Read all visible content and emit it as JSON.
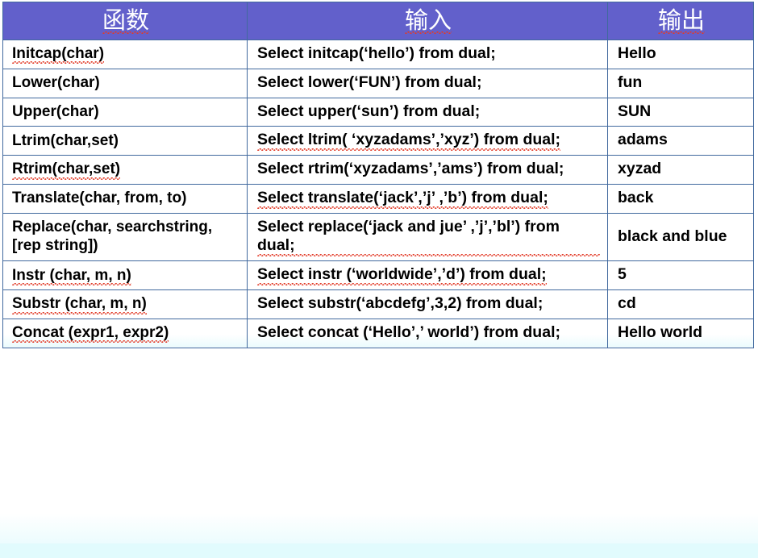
{
  "table": {
    "headers": [
      "函数",
      "输入",
      "输出"
    ],
    "rows": [
      {
        "function": "Initcap(char)",
        "input": "Select initcap(‘hello’) from dual;",
        "output": "Hello"
      },
      {
        "function": "Lower(char)",
        "input": "Select lower(‘FUN’) from dual;",
        "output": "fun"
      },
      {
        "function": "Upper(char)",
        "input": "Select upper(‘sun’) from dual;",
        "output": "SUN"
      },
      {
        "function": "Ltrim(char,set)",
        "input": "Select ltrim( ‘xyzadams’,’xyz’) from dual;",
        "output": "adams"
      },
      {
        "function": "Rtrim(char,set)",
        "input": "Select rtrim(‘xyzadams’,’ams’) from dual;",
        "output": "xyzad"
      },
      {
        "function": "Translate(char, from, to)",
        "input": "Select translate(‘jack’,’j’ ,’b’) from dual;",
        "output": "back"
      },
      {
        "function": "Replace(char, searchstring,[rep string])",
        "input": "Select replace(‘jack and jue’ ,’j’,’bl’) from dual;",
        "output": "black and blue"
      },
      {
        "function": "Instr (char, m, n)",
        "input": "Select instr (‘worldwide’,’d’) from dual;",
        "output": "5"
      },
      {
        "function": "Substr (char, m, n)",
        "input": "Select substr(‘abcdefg’,3,2) from dual;",
        "output": "cd"
      },
      {
        "function": "Concat (expr1, expr2)",
        "input": "Select concat (‘Hello’,’ world’) from dual;",
        "output": "Hello world"
      }
    ]
  },
  "colors": {
    "header_background": "#6260cb",
    "header_text": "#ffffff",
    "border": "#41699e",
    "cell_background": "#ffffff",
    "cell_text": "#000000",
    "spellcheck_underline": "#e23a27",
    "page_bottom_tint": "#e1fbfd"
  }
}
